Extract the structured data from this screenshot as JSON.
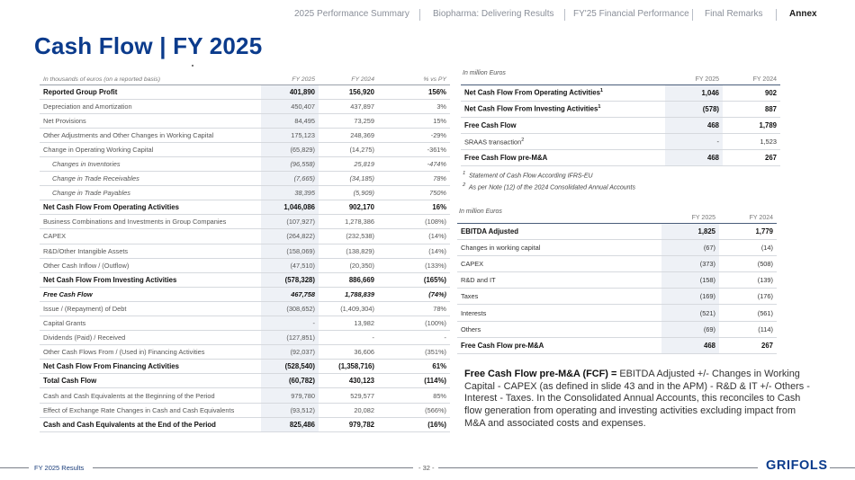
{
  "nav": {
    "items": [
      "2025 Performance Summary",
      "Biopharma: Delivering Results",
      "FY'25 Financial Performance",
      "Final Remarks",
      "Annex"
    ]
  },
  "title": "Cash Flow | FY 2025",
  "left_table": {
    "headers": [
      "In thousands of euros (on a reported basis)",
      "FY 2025",
      "FY 2024",
      "% vs PY"
    ],
    "rows": [
      {
        "label": "Reported Group Profit",
        "fy2025": "401,890",
        "fy2024": "156,920",
        "pct": "156%",
        "style": "bold"
      },
      {
        "label": "Depreciation and Amortization",
        "fy2025": "450,407",
        "fy2024": "437,897",
        "pct": "3%",
        "style": ""
      },
      {
        "label": "Net Provisions",
        "fy2025": "84,495",
        "fy2024": "73,259",
        "pct": "15%",
        "style": ""
      },
      {
        "label": "Other Adjustments and Other Changes in Working Capital",
        "fy2025": "175,123",
        "fy2024": "248,369",
        "pct": "-29%",
        "style": ""
      },
      {
        "label": "Change in Operating Working Capital",
        "fy2025": "(65,829)",
        "fy2024": "(14,275)",
        "pct": "-361%",
        "style": ""
      },
      {
        "label": "Changes in Inventories",
        "fy2025": "(96,558)",
        "fy2024": "25,819",
        "pct": "-474%",
        "style": "ital"
      },
      {
        "label": "Change in Trade Receivables",
        "fy2025": "(7,665)",
        "fy2024": "(34,185)",
        "pct": "78%",
        "style": "ital"
      },
      {
        "label": "Change in Trade Payables",
        "fy2025": "38,395",
        "fy2024": "(5,909)",
        "pct": "750%",
        "style": "ital"
      },
      {
        "label": "Net Cash Flow From Operating Activities",
        "fy2025": "1,046,086",
        "fy2024": "902,170",
        "pct": "16%",
        "style": "bold"
      },
      {
        "label": "Business Combinations and Investments in Group Companies",
        "fy2025": "(107,927)",
        "fy2024": "1,278,386",
        "pct": "(108%)",
        "style": ""
      },
      {
        "label": "CAPEX",
        "fy2025": "(264,822)",
        "fy2024": "(232,538)",
        "pct": "(14%)",
        "style": ""
      },
      {
        "label": "R&D/Other Intangible Assets",
        "fy2025": "(158,069)",
        "fy2024": "(138,829)",
        "pct": "(14%)",
        "style": ""
      },
      {
        "label": "Other Cash Inflow / (Outflow)",
        "fy2025": "(47,510)",
        "fy2024": "(20,350)",
        "pct": "(133%)",
        "style": ""
      },
      {
        "label": "Net Cash Flow From Investing Activities",
        "fy2025": "(578,328)",
        "fy2024": "886,669",
        "pct": "(165%)",
        "style": "bold"
      },
      {
        "label": "Free Cash Flow",
        "fy2025": "467,758",
        "fy2024": "1,788,839",
        "pct": "(74%)",
        "style": "boldital"
      },
      {
        "label": "Issue / (Repayment) of Debt",
        "fy2025": "(308,652)",
        "fy2024": "(1,409,304)",
        "pct": "78%",
        "style": ""
      },
      {
        "label": "Capital Grants",
        "fy2025": "-",
        "fy2024": "13,982",
        "pct": "(100%)",
        "style": ""
      },
      {
        "label": "Dividends (Paid) / Received",
        "fy2025": "(127,851)",
        "fy2024": "-",
        "pct": "-",
        "style": ""
      },
      {
        "label": "Other Cash Flows From / (Used in) Financing Activities",
        "fy2025": "(92,037)",
        "fy2024": "36,606",
        "pct": "(351%)",
        "style": ""
      },
      {
        "label": "Net Cash Flow From Financing Activities",
        "fy2025": "(528,540)",
        "fy2024": "(1,358,716)",
        "pct": "61%",
        "style": "bold"
      },
      {
        "label": "Total Cash Flow",
        "fy2025": "(60,782)",
        "fy2024": "430,123",
        "pct": "(114%)",
        "style": "bold"
      },
      {
        "label": "Cash and Cash Equivalents at the Beginning of the Period",
        "fy2025": "979,780",
        "fy2024": "529,577",
        "pct": "85%",
        "style": ""
      },
      {
        "label": "Effect of Exchange Rate Changes in Cash and Cash Equivalents",
        "fy2025": "(93,512)",
        "fy2024": "20,082",
        "pct": "(566%)",
        "style": ""
      },
      {
        "label": "Cash and Cash Equivalents at the End of the Period",
        "fy2025": "825,486",
        "fy2024": "979,782",
        "pct": "(16%)",
        "style": "bold"
      }
    ]
  },
  "right_table1": {
    "caption": "In million Euros",
    "headers": [
      "FY 2025",
      "FY 2024"
    ],
    "rows": [
      {
        "label": "Net Cash Flow From Operating Activities",
        "sup": "1",
        "fy2025": "1,046",
        "fy2024": "902",
        "style": "bold"
      },
      {
        "label": "Net Cash Flow From Investing Activities",
        "sup": "1",
        "fy2025": "(578)",
        "fy2024": "887",
        "style": "bold"
      },
      {
        "label": "Free Cash Flow",
        "sup": "",
        "fy2025": "468",
        "fy2024": "1,789",
        "style": "bold"
      },
      {
        "label": "SRAAS transaction",
        "sup": "2",
        "fy2025": "-",
        "fy2024": "1,523",
        "style": ""
      },
      {
        "label": "Free Cash Flow pre-M&A",
        "sup": "",
        "fy2025": "468",
        "fy2024": "267",
        "style": "bold"
      }
    ],
    "notes": [
      "Statement of Cash Flow According IFRS-EU",
      "As per Note (12) of the 2024 Consolidated Annual Accounts"
    ],
    "note_marks": [
      "1",
      "2"
    ]
  },
  "right_table2": {
    "caption": "In million Euros",
    "headers": [
      "FY 2025",
      "FY 2024"
    ],
    "rows": [
      {
        "label": "EBITDA Adjusted",
        "fy2025": "1,825",
        "fy2024": "1,779",
        "style": "bold"
      },
      {
        "label": "Changes in working capital",
        "fy2025": "(67)",
        "fy2024": "(14)",
        "style": ""
      },
      {
        "label": "CAPEX",
        "fy2025": "(373)",
        "fy2024": "(508)",
        "style": ""
      },
      {
        "label": "R&D and IT",
        "fy2025": "(158)",
        "fy2024": "(139)",
        "style": ""
      },
      {
        "label": "Taxes",
        "fy2025": "(169)",
        "fy2024": "(176)",
        "style": ""
      },
      {
        "label": "Interests",
        "fy2025": "(521)",
        "fy2024": "(561)",
        "style": ""
      },
      {
        "label": "Others",
        "fy2025": "(69)",
        "fy2024": "(114)",
        "style": ""
      },
      {
        "label": "Free Cash Flow pre-M&A",
        "fy2025": "468",
        "fy2024": "267",
        "style": "bold"
      }
    ]
  },
  "fcf_note": {
    "bold": "Free Cash Flow pre-M&A (FCF) =",
    "text": " EBITDA Adjusted +/- Changes in Working Capital - CAPEX (as defined in slide 43 and in the APM) - R&D & IT +/- Others - Interest - Taxes. In the Consolidated Annual Accounts, this reconciles to Cash flow generation from operating and investing activities excluding impact from M&A and associated costs and expenses."
  },
  "footer": {
    "left": "FY 2025 Results",
    "page": "- 32 -",
    "logo": "GRIFOLS"
  },
  "colors": {
    "brand_blue": "#0b3b8c",
    "highlight_column": "#eef1f6"
  }
}
